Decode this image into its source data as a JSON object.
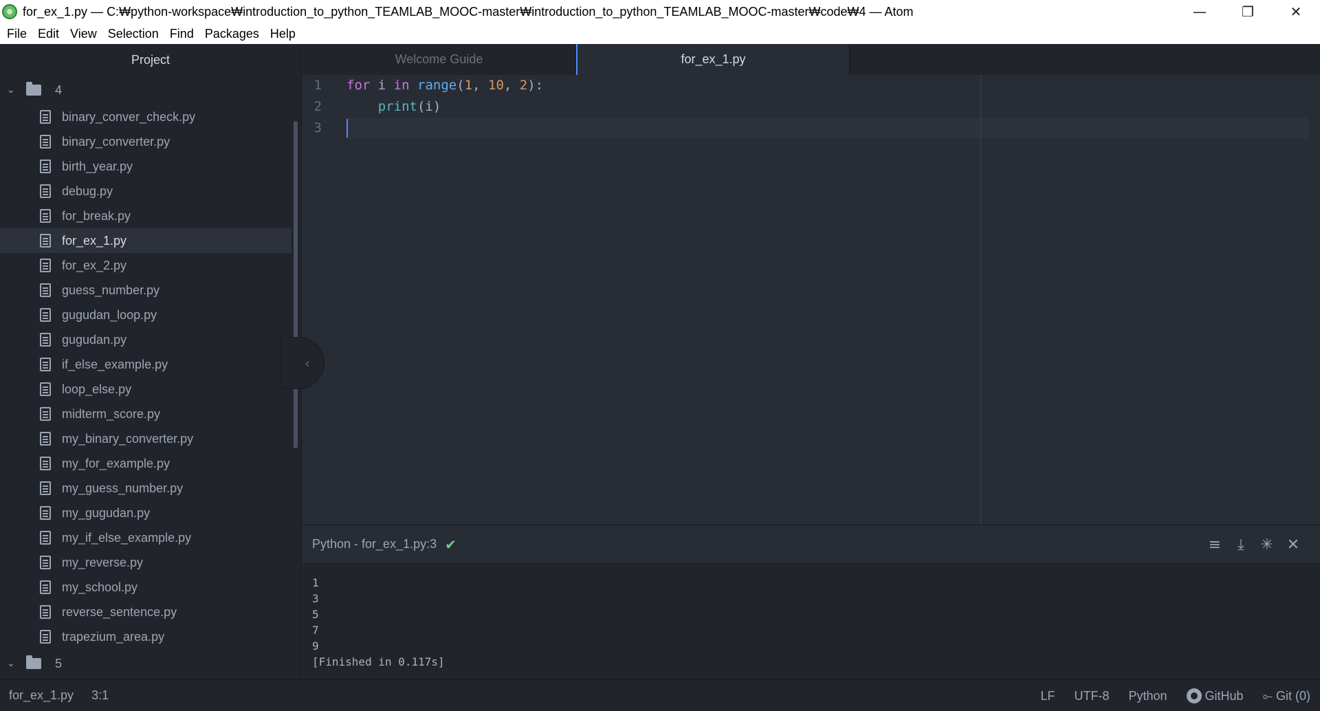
{
  "window": {
    "title": "for_ex_1.py — C:₩python-workspace₩introduction_to_python_TEAMLAB_MOOC-master₩introduction_to_python_TEAMLAB_MOOC-master₩code₩4 — Atom",
    "minimize": "—",
    "restore": "❐",
    "close": "✕"
  },
  "menu": [
    "File",
    "Edit",
    "View",
    "Selection",
    "Find",
    "Packages",
    "Help"
  ],
  "sidebar": {
    "title": "Project",
    "folder_open": "4",
    "folder_closed": "5",
    "files": [
      "binary_conver_check.py",
      "binary_converter.py",
      "birth_year.py",
      "debug.py",
      "for_break.py",
      "for_ex_1.py",
      "for_ex_2.py",
      "guess_number.py",
      "gugudan_loop.py",
      "gugudan.py",
      "if_else_example.py",
      "loop_else.py",
      "midterm_score.py",
      "my_binary_converter.py",
      "my_for_example.py",
      "my_guess_number.py",
      "my_gugudan.py",
      "my_if_else_example.py",
      "my_reverse.py",
      "my_school.py",
      "reverse_sentence.py",
      "trapezium_area.py"
    ],
    "selected_file": "for_ex_1.py"
  },
  "tabs": [
    {
      "label": "Welcome Guide",
      "active": false
    },
    {
      "label": "for_ex_1.py",
      "active": true
    }
  ],
  "editor": {
    "line_numbers": [
      "1",
      "2",
      "3"
    ],
    "lines": [
      [
        {
          "t": "for",
          "c": "kw"
        },
        {
          "t": " i ",
          "c": ""
        },
        {
          "t": "in",
          "c": "kw"
        },
        {
          "t": " ",
          "c": ""
        },
        {
          "t": "range",
          "c": "fn"
        },
        {
          "t": "(",
          "c": ""
        },
        {
          "t": "1",
          "c": "num"
        },
        {
          "t": ", ",
          "c": ""
        },
        {
          "t": "10",
          "c": "num"
        },
        {
          "t": ", ",
          "c": ""
        },
        {
          "t": "2",
          "c": "num"
        },
        {
          "t": "):",
          "c": ""
        }
      ],
      [
        {
          "t": "    ",
          "c": ""
        },
        {
          "t": "print",
          "c": "bi"
        },
        {
          "t": "(i)",
          "c": ""
        }
      ],
      []
    ],
    "collapse_glyph": "‹"
  },
  "output_panel": {
    "title": "Python - for_ex_1.py:3",
    "status_icon": "✔",
    "tools": [
      {
        "name": "copy-output-icon",
        "glyph": "≡"
      },
      {
        "name": "download-icon",
        "glyph": "⤓"
      },
      {
        "name": "pin-icon",
        "glyph": "✳"
      },
      {
        "name": "close-panel-icon",
        "glyph": "✕"
      }
    ],
    "output": [
      "1",
      "3",
      "5",
      "7",
      "9",
      "[Finished in 0.117s]"
    ]
  },
  "statusbar": {
    "file": "for_ex_1.py",
    "cursor": "3:1",
    "line_ending": "LF",
    "encoding": "UTF-8",
    "grammar": "Python",
    "github": "GitHub",
    "git": "Git (0)",
    "git_glyph": "⟜"
  },
  "colors": {
    "accent": "#528bff",
    "success": "#73c990",
    "keyword": "#c678dd",
    "function": "#61afef",
    "number": "#d19a66",
    "builtin": "#56b6c2"
  }
}
